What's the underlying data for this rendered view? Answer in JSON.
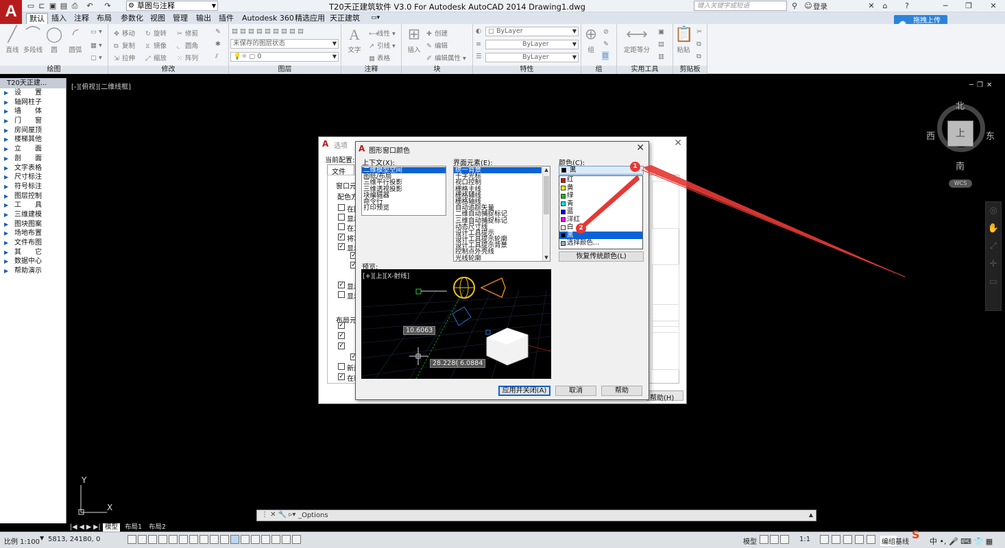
{
  "titlebar": {
    "app_title": "T20天正建筑软件 V3.0 For Autodesk AutoCAD 2014    Drawing1.dwg",
    "workspace": "草图与注释",
    "search_placeholder": "键入关键字或短语",
    "login": "登录"
  },
  "menu_tabs": [
    "默认",
    "插入",
    "注释",
    "布局",
    "参数化",
    "视图",
    "管理",
    "输出",
    "插件",
    "Autodesk 360",
    "精选应用",
    "天正建筑"
  ],
  "cloud_button": "拖拽上传",
  "ribbon": {
    "panels": [
      "绘图",
      "修改",
      "图层",
      "注释",
      "块",
      "特性",
      "组",
      "实用工具",
      "剪贴板"
    ],
    "draw_tools": [
      "直线",
      "多段线",
      "圆",
      "圆弧"
    ],
    "modify_tools": [
      "移动",
      "旋转",
      "修剪",
      "复制",
      "镜像",
      "圆角",
      "拉伸",
      "缩放",
      "阵列"
    ],
    "layer_state": "未保存的图层状态",
    "layer_current": "0",
    "annotation_tools": [
      "文字",
      "线性",
      "引线",
      "表格"
    ],
    "block_tools": [
      "插入",
      "创建",
      "编辑",
      "编辑属性"
    ],
    "property_values": [
      "ByLayer",
      "ByLayer",
      "ByLayer"
    ],
    "group_label": "组",
    "utility_label": "定距等分",
    "clipboard_label": "粘贴"
  },
  "sidebar": {
    "header": "T20天正建...",
    "items": [
      "设　　置",
      "轴网柱子",
      "墙　　体",
      "门　　窗",
      "房间屋顶",
      "楼梯其他",
      "立　　面",
      "剖　　面",
      "文字表格",
      "尺寸标注",
      "符号标注",
      "图层控制",
      "工　　具",
      "三维建模",
      "图块图案",
      "场地布置",
      "文件布图",
      "其　　它",
      "数据中心",
      "帮助演示"
    ]
  },
  "viewport": {
    "label": "[-][俯视][二维线框]",
    "compass": {
      "north": "北",
      "south": "南",
      "east": "东",
      "west": "西",
      "top": "上"
    },
    "wcs": "WCS",
    "ucs_x": "X",
    "ucs_y": "Y"
  },
  "command_line": {
    "text": "_Options"
  },
  "layout_tabs": [
    "模型",
    "布局1",
    "布局2"
  ],
  "statusbar": {
    "scale": "比例 1:100",
    "coords": "5813,  24180,  0",
    "model": "模型",
    "annotation_scale": "1:1",
    "edit_group": "编组",
    "baseline": "基线"
  },
  "options_dialog": {
    "title": "选项",
    "current_profile": "当前配置:",
    "tab_file": "文件",
    "section_window": "窗口元",
    "section_color": "配色方",
    "section_layout": "布局元",
    "rows": [
      "在图",
      "显示",
      "在工",
      "将功",
      "显示",
      "显示",
      "显示",
      "新建",
      "在新"
    ],
    "help_label": "帮助(H)"
  },
  "color_dialog": {
    "title": "图形窗口颜色",
    "context_label": "上下文(X):",
    "contexts": [
      "二维模型空间",
      "图纸/布局",
      "三维平行投影",
      "三维透视投影",
      "块编辑器",
      "命令行",
      "打印预览"
    ],
    "element_label": "界面元素(E):",
    "elements": [
      "统一背景",
      "十字光标",
      "视口控制",
      "栅格主线",
      "栅格辅线",
      "栅格轴线",
      "自动追踪矢量",
      "二维自动捕捉标记",
      "三维自动捕捉标记",
      "动态尺寸线",
      "设计工具提示",
      "设计工具提示轮廓",
      "设计工具提示背景",
      "控制点外壳线",
      "光线轮廓"
    ],
    "color_label": "颜色(C):",
    "current_color": "黑",
    "colors": [
      {
        "name": "红",
        "hex": "#ff0000"
      },
      {
        "name": "黄",
        "hex": "#ffff00"
      },
      {
        "name": "绿",
        "hex": "#00cc00"
      },
      {
        "name": "青",
        "hex": "#00e5e5"
      },
      {
        "name": "蓝",
        "hex": "#0000ff"
      },
      {
        "name": "洋红",
        "hex": "#ff00ff"
      },
      {
        "name": "白",
        "hex": "#ffffff"
      },
      {
        "name": "黑",
        "hex": "#000000"
      },
      {
        "name": "选择颜色...",
        "hex": "#9ab"
      }
    ],
    "restore_button": "恢复传统颜色(L)",
    "preview_label": "预览:",
    "preview_viewport": "[+][上][X-射线]",
    "preview_dims": [
      "10.6063",
      "28.2280",
      "6.0884"
    ],
    "apply_button": "应用并关闭(A)",
    "cancel_button": "取消",
    "help_button": "帮助"
  },
  "annotations": {
    "badge1": "1",
    "badge2": "2",
    "arrow_color": "#e53935"
  },
  "colors": {
    "accent_blue": "#0a63d6",
    "autocad_red": "#b71c1c"
  }
}
